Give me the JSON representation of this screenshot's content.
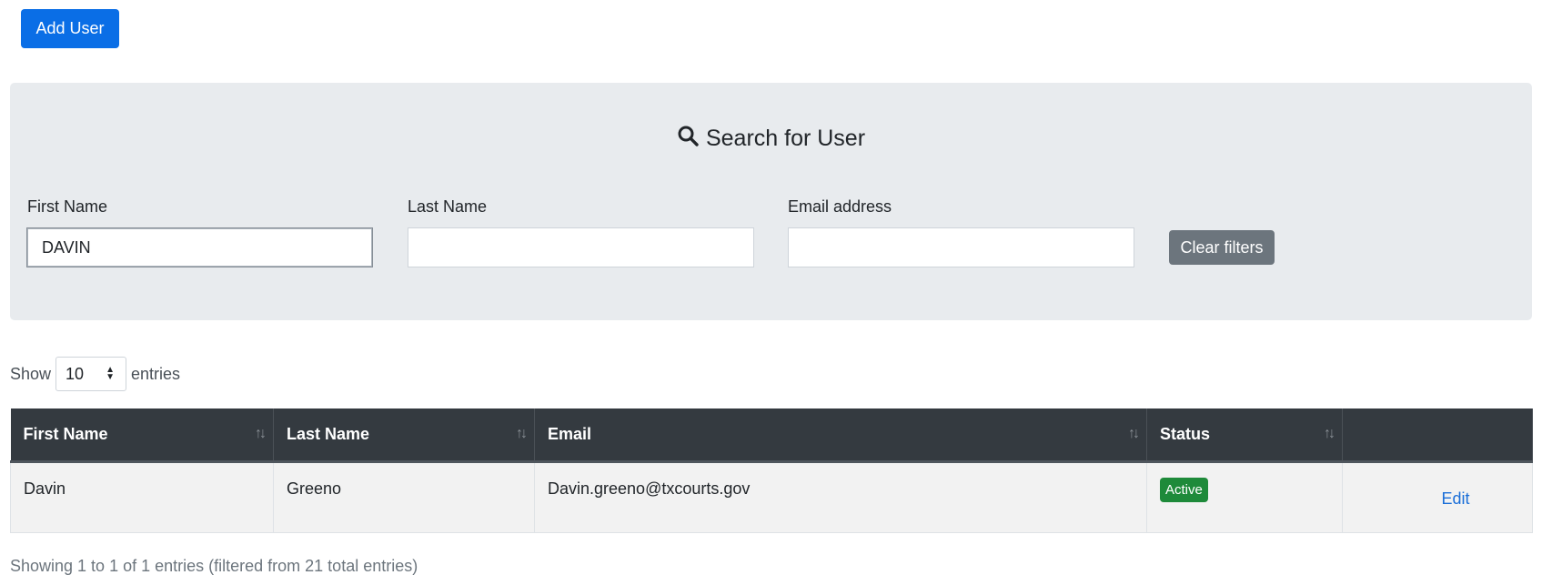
{
  "toolbar": {
    "add_user_label": "Add User"
  },
  "search": {
    "title": "Search for User",
    "fields": {
      "first_name": {
        "label": "First Name",
        "value": "DAVIN",
        "placeholder": ""
      },
      "last_name": {
        "label": "Last Name",
        "value": "",
        "placeholder": ""
      },
      "email": {
        "label": "Email address",
        "value": "",
        "placeholder": ""
      }
    },
    "clear_label": "Clear filters"
  },
  "length": {
    "show_label": "Show",
    "selected": "10",
    "entries_label": "entries"
  },
  "table": {
    "columns": [
      "First Name",
      "Last Name",
      "Email",
      "Status",
      ""
    ],
    "rows": [
      {
        "first_name": "Davin",
        "last_name": "Greeno",
        "email": "Davin.greeno@txcourts.gov",
        "status": "Active",
        "action": "Edit"
      }
    ]
  },
  "info": "Showing 1 to 1 of 1 entries (filtered from 21 total entries)",
  "colors": {
    "primary": "#0a6ee6",
    "secondary": "#6c757d",
    "header_dark": "#343a40",
    "success": "#1e8a3a",
    "panel_bg": "#e8ebee"
  }
}
